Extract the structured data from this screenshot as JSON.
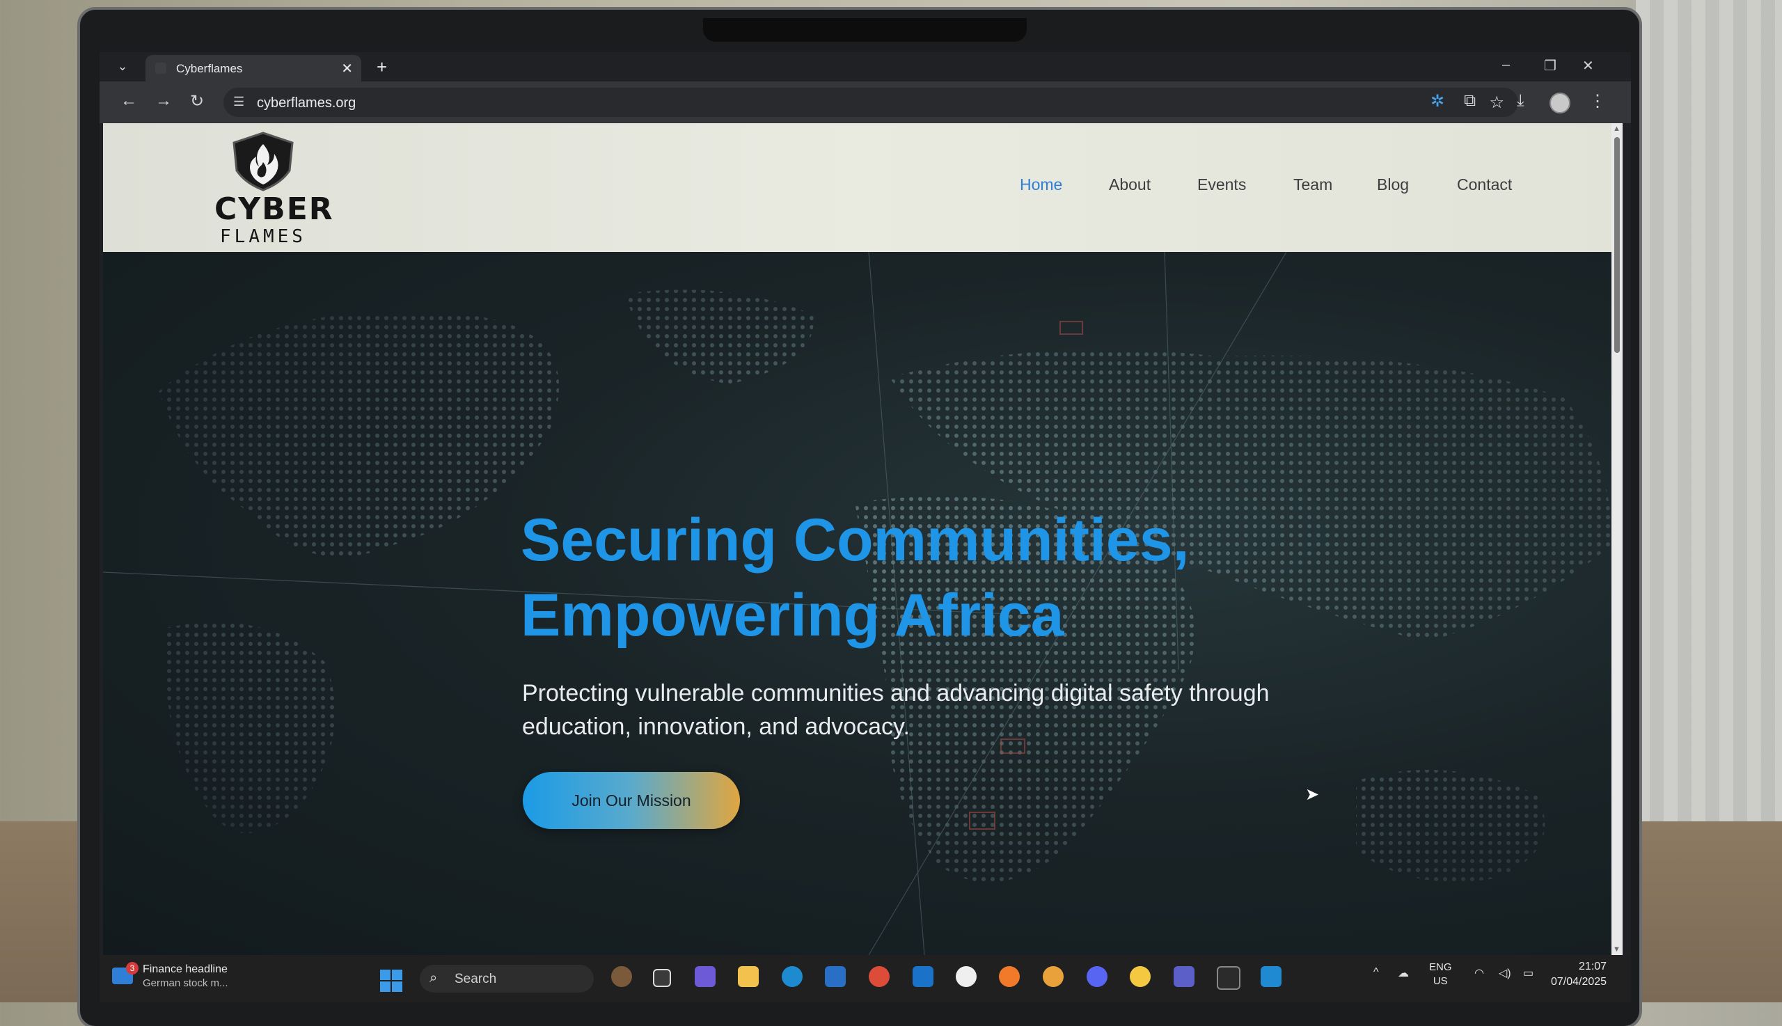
{
  "browser": {
    "tab_title": "Cyberflames",
    "tab_close": "✕",
    "new_tab": "+",
    "tab_dropdown": "⌄",
    "url": "cyberflames.org",
    "window_controls": [
      "–",
      "❐",
      "✕"
    ]
  },
  "site": {
    "logo": {
      "line1": "CYBER",
      "line2": "FLAMES"
    },
    "nav": [
      "Home",
      "About",
      "Events",
      "Team",
      "Blog",
      "Contact"
    ],
    "active_nav": "Home",
    "hero": {
      "title": "Securing Communities, Empowering Africa",
      "subtitle": "Protecting vulnerable communities and advancing digital safety through education, innovation, and advocacy.",
      "cta": "Join Our Mission"
    }
  },
  "taskbar": {
    "news_badge": "3",
    "news_title": "Finance headline",
    "news_sub": "German stock m...",
    "search_placeholder": "Search",
    "language": "ENG",
    "region": "US",
    "time": "21:07",
    "date": "07/04/2025"
  },
  "colors": {
    "accent": "#1e95e6",
    "nav_active": "#2f7fd6",
    "cta_start": "#1b9be6",
    "cta_end": "#e0a640"
  },
  "icons": [
    "back-icon",
    "forward-icon",
    "reload-icon",
    "site-info-icon",
    "star-icon",
    "extension-icon",
    "download-icon",
    "profile-icon",
    "menu-icon"
  ]
}
